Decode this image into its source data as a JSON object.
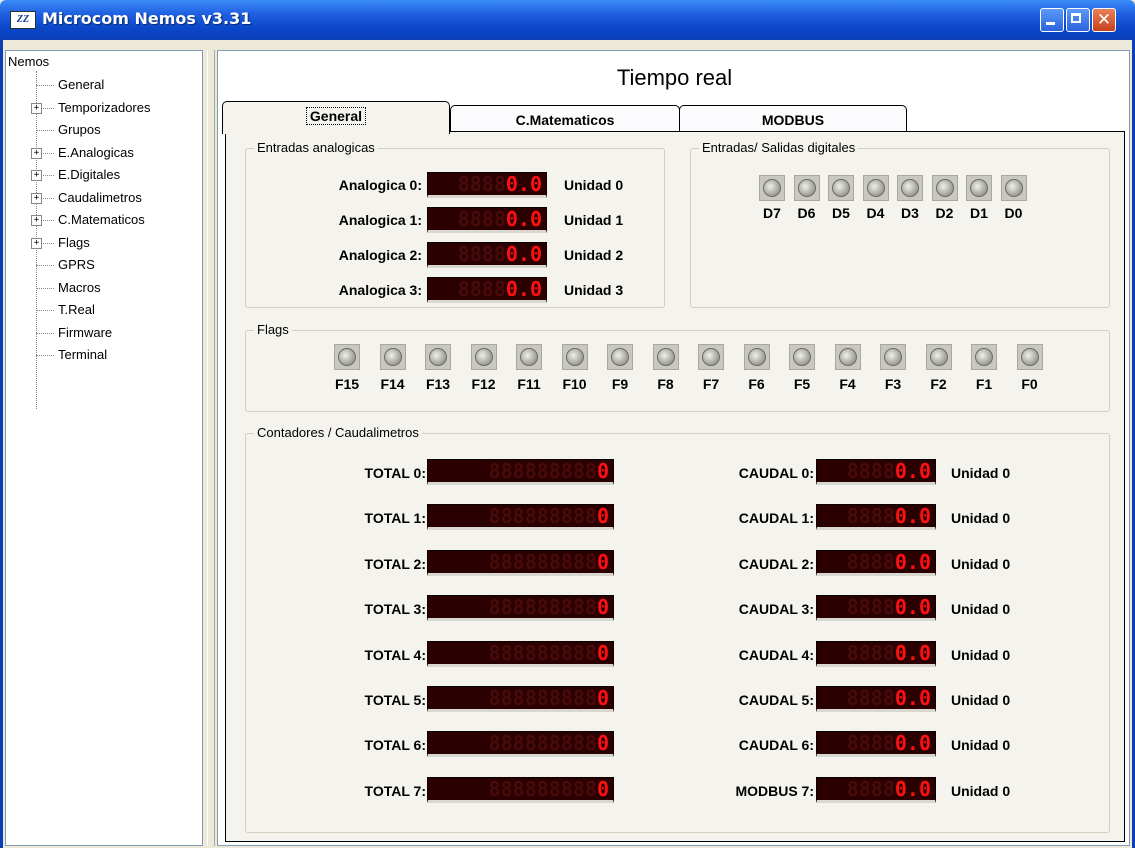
{
  "window": {
    "title": "Microcom Nemos v3.31",
    "icon_text": "ZZ"
  },
  "tree": {
    "root": "Nemos",
    "items": [
      {
        "label": "General",
        "expandable": false
      },
      {
        "label": "Temporizadores",
        "expandable": true
      },
      {
        "label": "Grupos",
        "expandable": false
      },
      {
        "label": "E.Analogicas",
        "expandable": true
      },
      {
        "label": "E.Digitales",
        "expandable": true
      },
      {
        "label": "Caudalimetros",
        "expandable": true
      },
      {
        "label": "C.Matematicos",
        "expandable": true
      },
      {
        "label": "Flags",
        "expandable": true
      },
      {
        "label": "GPRS",
        "expandable": false
      },
      {
        "label": "Macros",
        "expandable": false
      },
      {
        "label": "T.Real",
        "expandable": false
      },
      {
        "label": "Firmware",
        "expandable": false
      },
      {
        "label": "Terminal",
        "expandable": false
      }
    ],
    "expander_glyph": "+"
  },
  "main": {
    "title": "Tiempo real",
    "tabs": [
      {
        "label": "General",
        "active": true
      },
      {
        "label": "C.Matematicos",
        "active": false
      },
      {
        "label": "MODBUS",
        "active": false
      }
    ]
  },
  "analog": {
    "group_label": "Entradas analogicas",
    "rows": [
      {
        "label": "Analogica 0:",
        "ghost": "8888",
        "value": "0.0",
        "unit": "Unidad 0"
      },
      {
        "label": "Analogica 1:",
        "ghost": "8888",
        "value": "0.0",
        "unit": "Unidad 1"
      },
      {
        "label": "Analogica 2:",
        "ghost": "8888",
        "value": "0.0",
        "unit": "Unidad 2"
      },
      {
        "label": "Analogica 3:",
        "ghost": "8888",
        "value": "0.0",
        "unit": "Unidad 3"
      }
    ]
  },
  "digital": {
    "group_label": "Entradas/ Salidas digitales",
    "leds": [
      "D7",
      "D6",
      "D5",
      "D4",
      "D3",
      "D2",
      "D1",
      "D0"
    ]
  },
  "flags": {
    "group_label": "Flags",
    "leds": [
      "F15",
      "F14",
      "F13",
      "F12",
      "F11",
      "F10",
      "F9",
      "F8",
      "F7",
      "F6",
      "F5",
      "F4",
      "F3",
      "F2",
      "F1",
      "F0"
    ]
  },
  "counters": {
    "group_label": "Contadores / Caudalimetros",
    "totals": [
      {
        "label": "TOTAL 0:",
        "ghost": "888888888",
        "value": "0"
      },
      {
        "label": "TOTAL 1:",
        "ghost": "888888888",
        "value": "0"
      },
      {
        "label": "TOTAL 2:",
        "ghost": "888888888",
        "value": "0"
      },
      {
        "label": "TOTAL 3:",
        "ghost": "888888888",
        "value": "0"
      },
      {
        "label": "TOTAL 4:",
        "ghost": "888888888",
        "value": "0"
      },
      {
        "label": "TOTAL 5:",
        "ghost": "888888888",
        "value": "0"
      },
      {
        "label": "TOTAL 6:",
        "ghost": "888888888",
        "value": "0"
      },
      {
        "label": "TOTAL 7:",
        "ghost": "888888888",
        "value": "0"
      }
    ],
    "flows": [
      {
        "label": "CAUDAL 0:",
        "ghost": "8888",
        "value": "0.0",
        "unit": "Unidad 0"
      },
      {
        "label": "CAUDAL 1:",
        "ghost": "8888",
        "value": "0.0",
        "unit": "Unidad 0"
      },
      {
        "label": "CAUDAL 2:",
        "ghost": "8888",
        "value": "0.0",
        "unit": "Unidad 0"
      },
      {
        "label": "CAUDAL 3:",
        "ghost": "8888",
        "value": "0.0",
        "unit": "Unidad 0"
      },
      {
        "label": "CAUDAL 4:",
        "ghost": "8888",
        "value": "0.0",
        "unit": "Unidad 0"
      },
      {
        "label": "CAUDAL 5:",
        "ghost": "8888",
        "value": "0.0",
        "unit": "Unidad 0"
      },
      {
        "label": "CAUDAL 6:",
        "ghost": "8888",
        "value": "0.0",
        "unit": "Unidad 0"
      },
      {
        "label": "MODBUS 7:",
        "ghost": "8888",
        "value": "0.0",
        "unit": "Unidad 0"
      }
    ]
  },
  "colors": {
    "lcd_on": "#ff1010",
    "lcd_off": "#4a0a0a",
    "lcd_bg": "#2a0000",
    "titlebar": "#0b47c9"
  }
}
